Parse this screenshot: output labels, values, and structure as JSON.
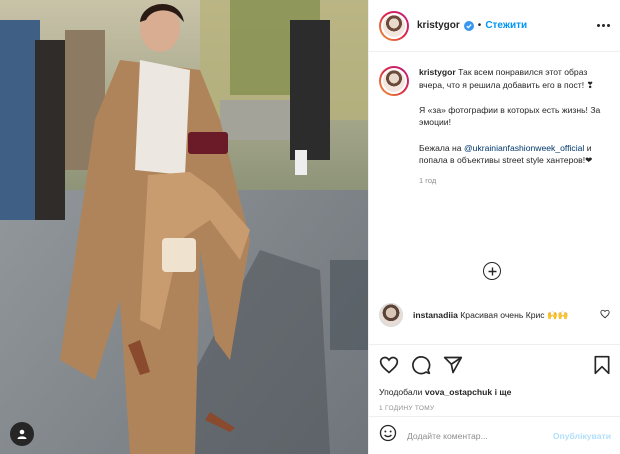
{
  "header": {
    "username": "kristygor",
    "separator": "•",
    "follow_label": "Стежити"
  },
  "caption": {
    "username": "kristygor",
    "paragraph1": "Так всем понравился этот образ вчера, что я решила добавить его в пост! ❣",
    "paragraph2": "Я «за» фотографии в которых есть жизнь! За эмоции!",
    "paragraph3_prefix": "Бежала на ",
    "paragraph3_mention": "@ukrainianfashionweek_official",
    "paragraph3_suffix": " и попала в объективы street style хантеров!❤",
    "time_ago": "1 год"
  },
  "comments": [
    {
      "username": "instanadiia",
      "text": "Красивая очень Крис 🙌🙌"
    }
  ],
  "likes": {
    "prefix": "Уподобали ",
    "liker": "vova_ostapchuk",
    "suffix": " і ще"
  },
  "timestamp": "1 ГОДИНУ ТОМУ",
  "comment_box": {
    "placeholder": "Додайте коментар...",
    "post_label": "Опублікувати"
  },
  "icons": {
    "verified": "verified-badge-icon",
    "more": "more-options-icon",
    "load_more": "plus-circle-icon",
    "like": "heart-icon",
    "comment": "comment-bubble-icon",
    "share": "paper-plane-icon",
    "save": "bookmark-icon",
    "emoji": "smiley-icon",
    "tag": "user-tag-icon"
  },
  "colors": {
    "accent": "#0095f6",
    "verified": "#3897f0",
    "mention": "#00376b",
    "post_disabled": "#b2dffc"
  }
}
